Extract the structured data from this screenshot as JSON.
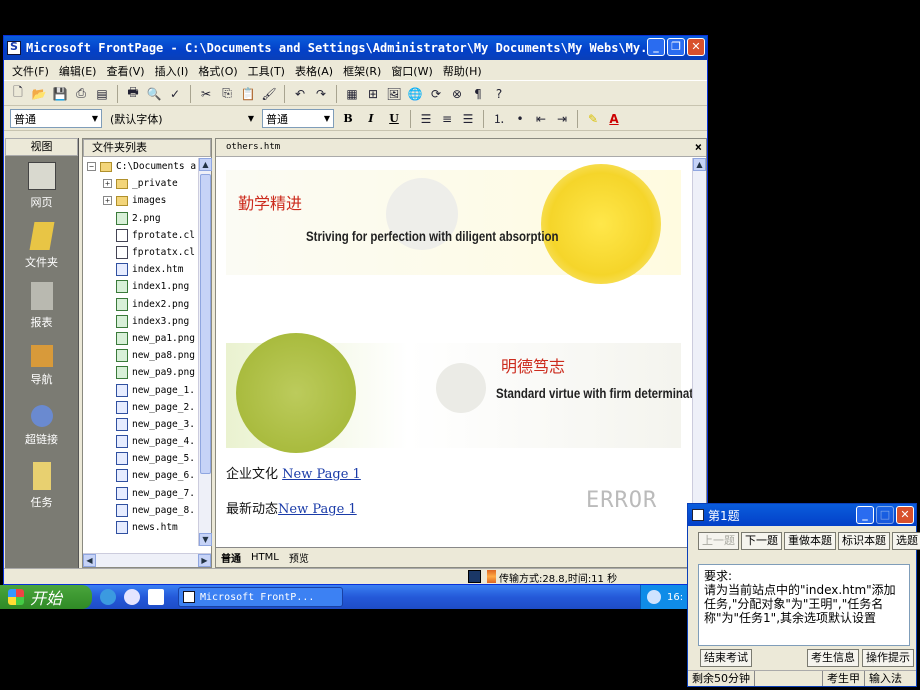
{
  "window": {
    "title": "Microsoft FrontPage - C:\\Documents and Settings\\Administrator\\My Documents\\My Webs\\My..."
  },
  "menu": [
    "文件(F)",
    "编辑(E)",
    "查看(V)",
    "插入(I)",
    "格式(O)",
    "工具(T)",
    "表格(A)",
    "框架(R)",
    "窗口(W)",
    "帮助(H)"
  ],
  "format_toolbar": {
    "style": "普通",
    "font": "(默认字体)",
    "size": "普通",
    "bold": "B",
    "italic": "I",
    "underline": "U"
  },
  "views_panel": {
    "header": "视图",
    "items": [
      "网页",
      "文件夹",
      "报表",
      "导航",
      "超链接",
      "任务"
    ]
  },
  "folder_panel": {
    "header": "文件夹列表",
    "items": [
      {
        "name": "C:\\Documents a",
        "type": "root"
      },
      {
        "name": "_private",
        "type": "folder"
      },
      {
        "name": "images",
        "type": "folder"
      },
      {
        "name": "2.png",
        "type": "png"
      },
      {
        "name": "fprotate.cl",
        "type": "file"
      },
      {
        "name": "fprotatx.cl",
        "type": "file"
      },
      {
        "name": "index.htm",
        "type": "htm"
      },
      {
        "name": "index1.png",
        "type": "png"
      },
      {
        "name": "index2.png",
        "type": "png"
      },
      {
        "name": "index3.png",
        "type": "png"
      },
      {
        "name": "new_pa1.png",
        "type": "png"
      },
      {
        "name": "new_pa8.png",
        "type": "png"
      },
      {
        "name": "new_pa9.png",
        "type": "png"
      },
      {
        "name": "new_page_1.",
        "type": "htm"
      },
      {
        "name": "new_page_2.",
        "type": "htm"
      },
      {
        "name": "new_page_3.",
        "type": "htm"
      },
      {
        "name": "new_page_4.",
        "type": "htm"
      },
      {
        "name": "new_page_5.",
        "type": "htm"
      },
      {
        "name": "new_page_6.",
        "type": "htm"
      },
      {
        "name": "new_page_7.",
        "type": "htm"
      },
      {
        "name": "new_page_8.",
        "type": "htm"
      },
      {
        "name": "news.htm",
        "type": "htm"
      }
    ]
  },
  "editor": {
    "tab_label": "others.htm",
    "banner1": {
      "cn": "勤学精进",
      "en": "Striving for perfection with diligent absorption"
    },
    "banner2": {
      "cn": "明德笃志",
      "en": "Standard virtue with firm determination"
    },
    "line1": {
      "label": "企业文化 ",
      "link": "New Page 1"
    },
    "line2": {
      "label": "最新动态",
      "link": "New Page 1"
    },
    "watermark": "ERROR",
    "bottom_tabs": [
      "普通",
      "HTML",
      "预览"
    ]
  },
  "statusbar": {
    "text": "传输方式:28.8,时间:11 秒"
  },
  "taskbar": {
    "start_label": "开始",
    "task_label": "Microsoft FrontP...",
    "clock": "16:"
  },
  "exam": {
    "title": "第1题",
    "buttons": [
      "上一题",
      "下一题",
      "重做本题",
      "标识本题",
      "选题"
    ],
    "content": "要求:\n请为当前站点中的\"index.htm\"添加任务,\"分配对象\"为\"王明\",\"任务名称\"为\"任务1\",其余选项默认设置",
    "end_button": "结束考试",
    "info_button": "考生信息",
    "hint_button": "操作提示",
    "status": [
      "剩余50分钟",
      "",
      "考生甲",
      "输入法"
    ]
  },
  "colors": {
    "title_blue": "#0a5ddc",
    "views_bg": "#7b7b73",
    "banner_red": "#cc2b1d",
    "link_blue": "#1a3ba8",
    "start_green": "#2f8a26"
  }
}
